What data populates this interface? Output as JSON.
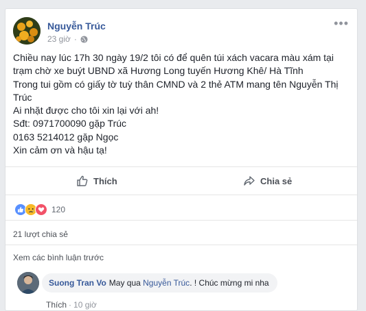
{
  "post": {
    "author": "Nguyễn Trúc",
    "time": "23 giờ",
    "lines": [
      "Chiều nay lúc 17h 30 ngày 19/2 tôi có để quên túi xách vacara màu xám tại",
      "trạm chờ xe buýt UBND xã Hương Long tuyến Hương Khê/ Hà Tĩnh",
      "Trong tui gồm có giấy tờ tuỳ thân CMND và 2 thẻ ATM mang tên Nguyễn Thị",
      "Trúc",
      "Ai nhặt được cho tôi xin lại với ah!",
      "Sđt: 0971700090 gặp Trúc",
      "0163 5214012 gặp Ngọc",
      "Xin cảm ơn và hậu tạ!"
    ]
  },
  "actions": {
    "like_label": "Thích",
    "share_label": "Chia sẻ"
  },
  "reactions": {
    "count": "120",
    "icons": [
      "like-icon",
      "sad-icon",
      "love-icon"
    ]
  },
  "shares": {
    "label": "21 lượt chia sẻ"
  },
  "comments": {
    "view_previous": "Xem các bình luận trước",
    "items": [
      {
        "author": "Suong Tran Vo",
        "text_before": "May qua ",
        "tag": "Nguyễn Trúc",
        "text_after": ". ! Chúc mừng mi nha",
        "like_label": "Thích",
        "time": "10 giờ"
      }
    ]
  },
  "colors": {
    "link": "#365899",
    "like_blue": "#5890ff",
    "love_red": "#f25268",
    "sad_yellow": "#f7b928",
    "background": "#e9ebee"
  }
}
